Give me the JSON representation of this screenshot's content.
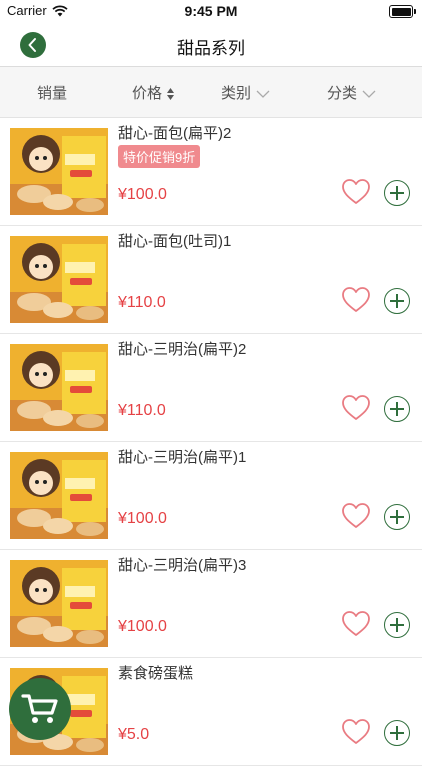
{
  "status_bar": {
    "carrier": "Carrier",
    "time": "9:45 PM"
  },
  "nav": {
    "title": "甜品系列"
  },
  "filters": [
    {
      "label": "销量"
    },
    {
      "label": "价格"
    },
    {
      "label": "类别"
    },
    {
      "label": "分类"
    }
  ],
  "products": [
    {
      "name": "甜心-面包(扁平)2",
      "promo": "特价促销9折",
      "price": "¥100.0"
    },
    {
      "name": "甜心-面包(吐司)1",
      "promo": "",
      "price": "¥110.0"
    },
    {
      "name": "甜心-三明治(扁平)2",
      "promo": "",
      "price": "¥110.0"
    },
    {
      "name": "甜心-三明治(扁平)1",
      "promo": "",
      "price": "¥100.0"
    },
    {
      "name": "甜心-三明治(扁平)3",
      "promo": "",
      "price": "¥100.0"
    },
    {
      "name": "素食磅蛋糕",
      "promo": "",
      "price": "¥5.0"
    }
  ],
  "colors": {
    "accent": "#2f6e3c",
    "price": "#e54245",
    "promo_bg": "#f08a8e",
    "heart": "#e97b82"
  },
  "icons": {
    "back": "chevron-left-icon",
    "cart": "shopping-cart-icon",
    "favorite": "heart-outline-icon",
    "add": "plus-circle-icon"
  }
}
